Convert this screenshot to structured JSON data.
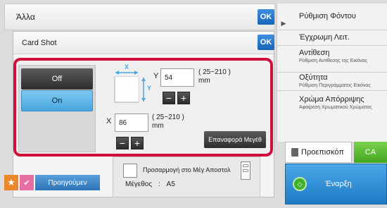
{
  "header": {
    "title": "Άλλα",
    "ok_label": "OK"
  },
  "dialog": {
    "title": "Card Shot",
    "ok_label": "OK"
  },
  "modes": {
    "off_label": "Off",
    "on_label": "On",
    "selected": "On"
  },
  "y_size": {
    "label": "Y",
    "value": "54",
    "range": "( 25~210 )",
    "unit": "mm"
  },
  "x_size": {
    "label": "X",
    "value": "86",
    "range": "( 25~210 )",
    "unit": "mm"
  },
  "diagram": {
    "x_label": "X",
    "y_label": "Y"
  },
  "steppers": {
    "minus": "−",
    "plus": "+"
  },
  "reset_label": "Επαναφορά Μεγέθ",
  "fit": {
    "label": "Προσαρμογή στο Μέγ Αποστολ"
  },
  "size": {
    "label": "Μέγεθος",
    "separator": ":",
    "value": "A5"
  },
  "right_panel": {
    "items": [
      {
        "main": "Ρύθμιση Φόντου",
        "sub": ""
      },
      {
        "main": "Έγχρωμη Λειτ.",
        "sub": ""
      },
      {
        "main": "Αντίθεση",
        "sub": "Ρύθμιση Αντίθεσης της Εικόνας"
      },
      {
        "main": "Οξύτητα",
        "sub": "Ρύθμιση Περιγράμματος Εικόνας"
      },
      {
        "main": "Χρώμα Απόρριψης",
        "sub": "Αφαίρεση Χρωματικού Χρώματος"
      }
    ]
  },
  "actions": {
    "preview_label": "Προεπισκόπ",
    "ca_label": "CA",
    "start_label": "Έναρξη"
  },
  "bottom": {
    "previous_label": "Προηγούμεν"
  },
  "colors": {
    "accent_blue": "#1d7bc6",
    "highlight_red": "#d0103a",
    "ca_green": "#43a520",
    "star_orange": "#e8872b"
  }
}
